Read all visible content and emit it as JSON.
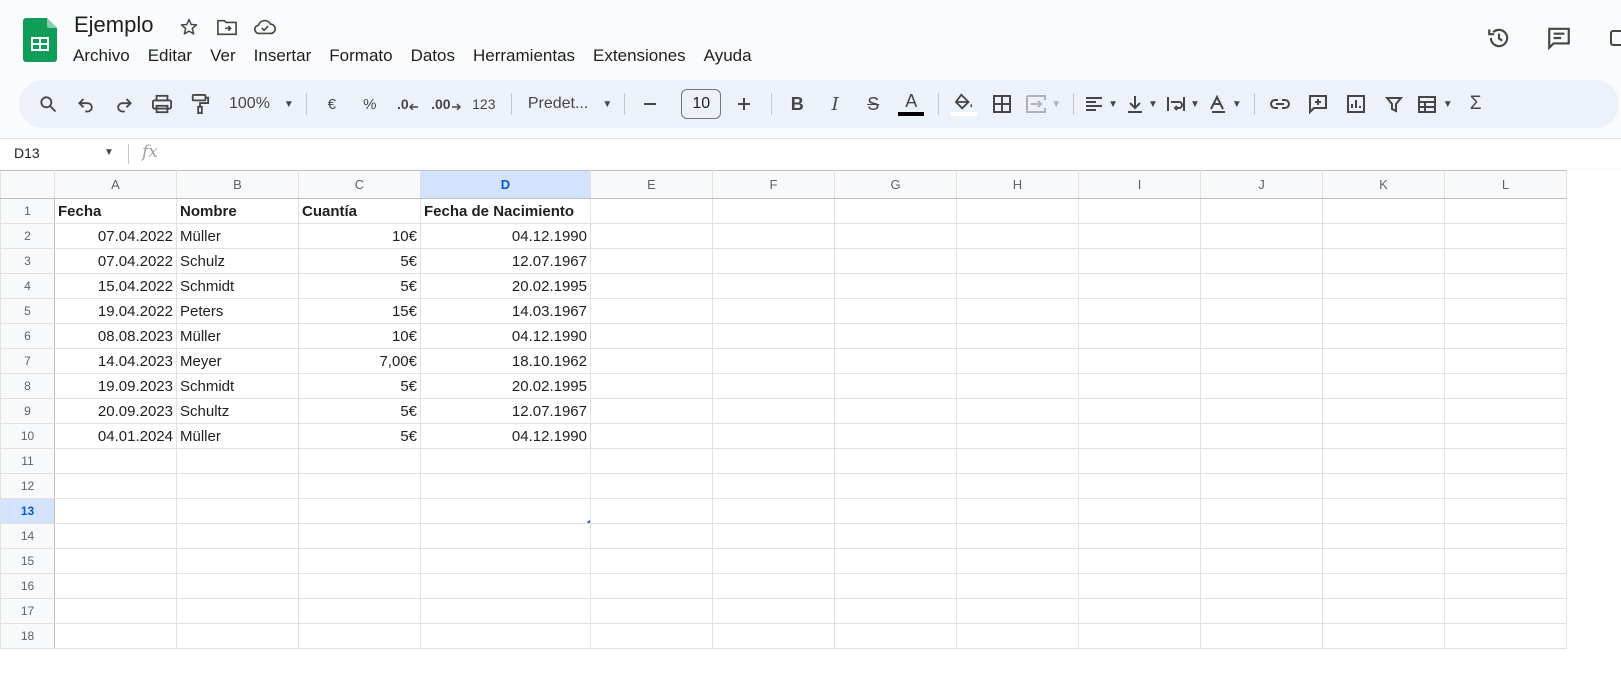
{
  "app": {
    "doc_title": "Ejemplo",
    "menu": [
      "Archivo",
      "Editar",
      "Ver",
      "Insertar",
      "Formato",
      "Datos",
      "Herramientas",
      "Extensiones",
      "Ayuda"
    ]
  },
  "toolbar": {
    "zoom": "100%",
    "currency_symbol": "€",
    "percent_symbol": "%",
    "decimal_decrease": ".0",
    "decimal_increase": ".00",
    "format_number": "123",
    "font_name": "Predet...",
    "font_size": "10",
    "bold_label": "B",
    "italic_label": "I",
    "strike_label": "S",
    "text_color_label": "A",
    "sum_label": "Σ"
  },
  "formula_bar": {
    "name_box": "D13",
    "fx_label": "fx"
  },
  "grid": {
    "columns": [
      "A",
      "B",
      "C",
      "D",
      "E",
      "F",
      "G",
      "H",
      "I",
      "J",
      "K",
      "L"
    ],
    "selected_column": "D",
    "selected_row": 13,
    "rows": [
      {
        "num": 1,
        "cells": [
          "Fecha",
          "Nombre",
          "Cuantía",
          "Fecha de Nacimiento"
        ]
      },
      {
        "num": 2,
        "cells": [
          "07.04.2022",
          "Müller",
          "10€",
          "04.12.1990"
        ]
      },
      {
        "num": 3,
        "cells": [
          "07.04.2022",
          "Schulz",
          "5€",
          "12.07.1967"
        ]
      },
      {
        "num": 4,
        "cells": [
          "15.04.2022",
          "Schmidt",
          "5€",
          "20.02.1995"
        ]
      },
      {
        "num": 5,
        "cells": [
          "19.04.2022",
          "Peters",
          "15€",
          "14.03.1967"
        ]
      },
      {
        "num": 6,
        "cells": [
          "08.08.2023",
          "Müller",
          "10€",
          "04.12.1990"
        ]
      },
      {
        "num": 7,
        "cells": [
          "14.04.2023",
          "Meyer",
          "7,00€",
          "18.10.1962"
        ]
      },
      {
        "num": 8,
        "cells": [
          "19.09.2023",
          "Schmidt",
          "5€",
          "20.02.1995"
        ]
      },
      {
        "num": 9,
        "cells": [
          "20.09.2023",
          "Schultz",
          "5€",
          "12.07.1967"
        ]
      },
      {
        "num": 10,
        "cells": [
          "04.01.2024",
          "Müller",
          "5€",
          "04.12.1990"
        ]
      },
      {
        "num": 11,
        "cells": []
      },
      {
        "num": 12,
        "cells": []
      },
      {
        "num": 13,
        "cells": []
      },
      {
        "num": 14,
        "cells": []
      },
      {
        "num": 15,
        "cells": []
      },
      {
        "num": 16,
        "cells": []
      },
      {
        "num": 17,
        "cells": []
      },
      {
        "num": 18,
        "cells": []
      }
    ]
  },
  "colors": {
    "accent": "#1a73e8",
    "sheets_green": "#0f9d58",
    "selection_header": "#d3e3fd"
  }
}
